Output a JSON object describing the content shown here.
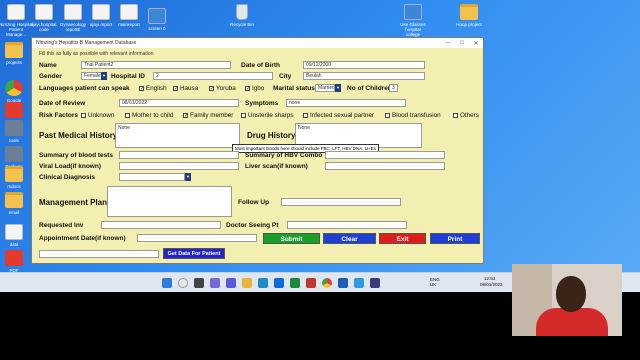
{
  "desktop_icons": [
    {
      "label": "Nimzing Hospital\nPatient Manage...",
      "kind": "doc"
    },
    {
      "label": "ajayi.hospital.\ncode",
      "kind": "doc"
    },
    {
      "label": "Gynaecology\nreportE",
      "kind": "doc"
    },
    {
      "label": "ajayi.report",
      "kind": "doc"
    },
    {
      "label": "mainreport",
      "kind": "doc"
    },
    {
      "label": "screen 0",
      "kind": "win"
    },
    {
      "label": "Recycle Bin",
      "kind": "bin"
    },
    {
      "label": "Use Glasses\nhospital\ncollege",
      "kind": "win"
    },
    {
      "label": "Hoop project",
      "kind": "folder"
    },
    {
      "label": "projects",
      "kind": "folder"
    },
    {
      "label": "Google\nChrome",
      "kind": "chrome"
    },
    {
      "label": "Acrobat\nReader",
      "kind": "pdf"
    },
    {
      "label": "tools",
      "kind": "app"
    },
    {
      "label": "Backups",
      "kind": "app"
    },
    {
      "label": "mdocs",
      "kind": "folder"
    },
    {
      "label": "email",
      "kind": "folder"
    },
    {
      "label": "data",
      "kind": "doc"
    },
    {
      "label": "PDF",
      "kind": "pdf"
    }
  ],
  "window": {
    "title": "Nimzing's Hepatitis B Management Database",
    "subtitle": "Fill this as fully as possible with relevant information",
    "controls": {
      "minimize": "–",
      "maximize": "□",
      "close": "✕"
    }
  },
  "form": {
    "name_label": "Name",
    "name_value": "Trial Patient2",
    "dob_label": "Date of Birth",
    "dob_value": "09/12/2000",
    "gender_label": "Gender",
    "gender_value": "Female",
    "hospital_id_label": "Hospital ID",
    "hospital_id_value": "2",
    "city_label": "City",
    "city_value": "Beulah",
    "languages_label": "Languages patient can speak",
    "languages": [
      {
        "label": "English",
        "checked": true
      },
      {
        "label": "Hausa",
        "checked": true
      },
      {
        "label": "Yoruba",
        "checked": true
      },
      {
        "label": "Igbo",
        "checked": true
      }
    ],
    "marital_label": "Marital status",
    "marital_value": "Married",
    "children_label": "No of Children",
    "children_value": "3",
    "review_label": "Date of Review",
    "review_value": "08/01/2022",
    "symptoms_label": "Symptoms",
    "symptoms_value": "none",
    "risk_label": "Risk Factors",
    "risks": [
      {
        "label": "Unknown",
        "checked": false
      },
      {
        "label": "Mother to child",
        "checked": false
      },
      {
        "label": "Family member",
        "checked": true
      },
      {
        "label": "Unsterile sharps",
        "checked": false
      },
      {
        "label": "Infected sexual partner",
        "checked": false
      },
      {
        "label": "Blood transfusion",
        "checked": false
      },
      {
        "label": "Others",
        "checked": false
      }
    ],
    "pmh_label": "Past Medical History",
    "pmh_value": "None",
    "drug_label": "Drug History",
    "drug_value": "None",
    "tooltip": "Most important bloods here should include FBC, LFT, HBV DNA, U+Es",
    "blood_label": "Summary of blood tests",
    "hbv_label": "Summary of HBV Combo",
    "viral_label": "Viral Load(if known)",
    "liver_label": "Liver scan(if known)",
    "clinical_label": "Clinical Diagnosis",
    "mgmt_label": "Management Plan",
    "followup_label": "Follow Up",
    "requested_label": "Requested Inv",
    "doctor_label": "Doctor Seeing Pt",
    "appt_label": "Appointment Date(if known)"
  },
  "buttons": {
    "submit": "Submit",
    "clear": "Clear",
    "exit": "Exit",
    "print": "Print",
    "get_data": "Get Data For Patient"
  },
  "colors": {
    "form_bg": "#f3efb1",
    "submit": "#1a9e2a",
    "clear": "#1f3fd6",
    "exit": "#e01b1b",
    "print": "#1f3fd6",
    "get_data": "#2424c8"
  },
  "taskbar": {
    "lang": "ENG\nUK",
    "time": "12:53",
    "date": "08/01/2022"
  }
}
